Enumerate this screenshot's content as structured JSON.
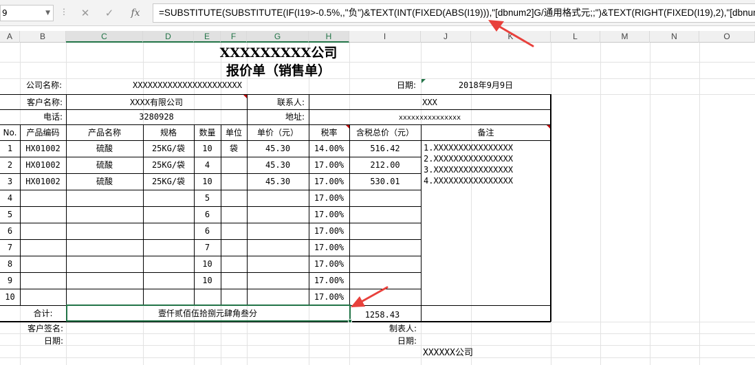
{
  "formula_bar": {
    "name_box": "9",
    "dropdown_glyph": "▼",
    "separator_glyph": "⋮",
    "cancel_glyph": "✕",
    "confirm_glyph": "✓",
    "fx_glyph": "fx",
    "formula": "=SUBSTITUTE(SUBSTITUTE(IF(I19>-0.5%,,\"负\")&TEXT(INT(FIXED(ABS(I19))),\"[dbnum2]G/通用格式元;;\")&TEXT(RIGHT(FIXED(I19),2),\"[dbnum2]0角0分;;整\"),\"零角\",IF(I19^2<1,,\"零\")),\"零分\",\"整\")"
  },
  "columns": [
    "A",
    "B",
    "C",
    "D",
    "E",
    "F",
    "G",
    "H",
    "I",
    "J",
    "K",
    "L",
    "M",
    "N",
    "O"
  ],
  "sheet": {
    "title1": "XXXXXXXXX公司",
    "title2": "报价单（销售单）",
    "company_label": "公司名称:",
    "company_value": "XXXXXXXXXXXXXXXXXXXXXX",
    "date_label": "日期:",
    "date_value": "2018年9月9日",
    "customer_label": "客户名称:",
    "customer_value": "XXXX有限公司",
    "contact_label": "联系人:",
    "contact_value": "XXX",
    "phone_label": "电话:",
    "phone_value": "3280928",
    "address_label": "地址:",
    "address_value": "xxxxxxxxxxxxxxx",
    "headers": [
      "No.",
      "产品编码",
      "产品名称",
      "规格",
      "数量",
      "单位",
      "单价（元）",
      "税率",
      "含税总价（元）",
      "备注"
    ],
    "rows": [
      {
        "no": "1",
        "code": "HX01002",
        "name": "硫酸",
        "spec": "25KG/袋",
        "qty": "10",
        "unit": "袋",
        "price": "45.30",
        "tax": "14.00%",
        "total": "516.42"
      },
      {
        "no": "2",
        "code": "HX01002",
        "name": "硫酸",
        "spec": "25KG/袋",
        "qty": "4",
        "unit": "",
        "price": "45.30",
        "tax": "17.00%",
        "total": "212.00"
      },
      {
        "no": "3",
        "code": "HX01002",
        "name": "硫酸",
        "spec": "25KG/袋",
        "qty": "10",
        "unit": "",
        "price": "45.30",
        "tax": "17.00%",
        "total": "530.01"
      },
      {
        "no": "4",
        "code": "",
        "name": "",
        "spec": "",
        "qty": "5",
        "unit": "",
        "price": "",
        "tax": "17.00%",
        "total": ""
      },
      {
        "no": "5",
        "code": "",
        "name": "",
        "spec": "",
        "qty": "6",
        "unit": "",
        "price": "",
        "tax": "17.00%",
        "total": ""
      },
      {
        "no": "6",
        "code": "",
        "name": "",
        "spec": "",
        "qty": "6",
        "unit": "",
        "price": "",
        "tax": "17.00%",
        "total": ""
      },
      {
        "no": "7",
        "code": "",
        "name": "",
        "spec": "",
        "qty": "7",
        "unit": "",
        "price": "",
        "tax": "17.00%",
        "total": ""
      },
      {
        "no": "8",
        "code": "",
        "name": "",
        "spec": "",
        "qty": "10",
        "unit": "",
        "price": "",
        "tax": "17.00%",
        "total": ""
      },
      {
        "no": "9",
        "code": "",
        "name": "",
        "spec": "",
        "qty": "10",
        "unit": "",
        "price": "",
        "tax": "17.00%",
        "total": ""
      },
      {
        "no": "10",
        "code": "",
        "name": "",
        "spec": "",
        "qty": "",
        "unit": "",
        "price": "",
        "tax": "17.00%",
        "total": ""
      }
    ],
    "remarks": [
      "1.XXXXXXXXXXXXXXXX",
      "2.XXXXXXXXXXXXXXXX",
      "3.XXXXXXXXXXXXXXXX",
      "4.XXXXXXXXXXXXXXXX"
    ],
    "total_label": "合计:",
    "total_words": "壹仟贰佰伍拾捌元肆角叁分",
    "total_value": "1258.43",
    "customer_sign_label": "客户签名:",
    "preparer_label": "制表人:",
    "sign_date_label": "日期:",
    "sign_date_label2": "日期:",
    "footer_company": "XXXXXX公司"
  },
  "colors": {
    "excel_green": "#217346",
    "arrow_red": "#e8413c",
    "comment_red": "#c00000"
  }
}
